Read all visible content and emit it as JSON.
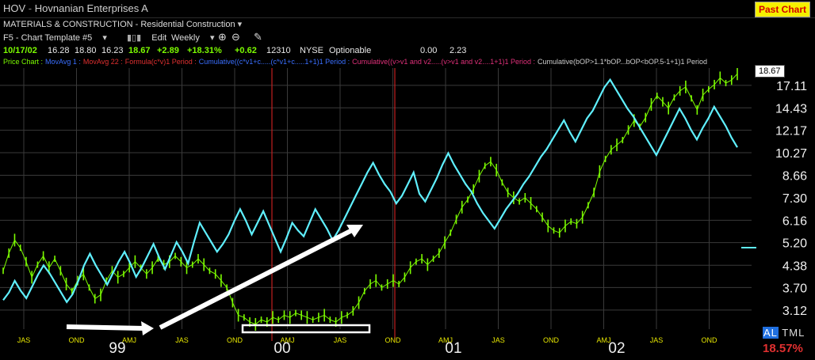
{
  "header": {
    "symbol": "HOV",
    "separator": "-",
    "company": "Hovnanian Enterprises A",
    "past_chart_label": "Past Chart"
  },
  "sector": {
    "label": "MATERIALS & CONSTRUCTION - Residential Construction"
  },
  "toolbar": {
    "template": "F5 - Chart Template #5",
    "edit_label": "Edit",
    "period": "Weekly"
  },
  "quote": {
    "date": "10/17/02",
    "open": "16.28",
    "high": "18.80",
    "low": "16.23",
    "last": "18.67",
    "change": "+2.89",
    "pct_change": "+18.31%",
    "extra_change": "+0.62",
    "volume": "12310",
    "exchange": "NYSE",
    "optionable": "Optionable",
    "val1": "0.00",
    "val2": "2.23"
  },
  "indicators": [
    {
      "text": "Price Chart :",
      "color": "#7cfc00"
    },
    {
      "text": "MovAvg 1 :",
      "color": "#3a6fff"
    },
    {
      "text": "MovAvg 22 :",
      "color": "#e03030"
    },
    {
      "text": "Formula(c*v)1 Period :",
      "color": "#e03030"
    },
    {
      "text": "Cumulative((c*v1+c.....(c*v1+c.....1+1)1 Period :",
      "color": "#3a6fff"
    },
    {
      "text": "Cumulative((v>v1 and v2.....(v>v1 and v2....1+1)1 Period :",
      "color": "#e0307a"
    },
    {
      "text": "Cumulative(bOP>1.1*bOP...bOP<bOP.5-1+1)1 Period",
      "color": "#cccccc"
    }
  ],
  "colors": {
    "price": "#7cfc00",
    "indicator": "#5ff0ff",
    "divider": "#c02020",
    "grid": "#3a3a3a",
    "xlabel": "#e6e600"
  },
  "price_axis": {
    "last_label": "18.67",
    "ticks": [
      "17.11",
      "14.43",
      "12.17",
      "10.27",
      "8.66",
      "7.30",
      "6.16",
      "5.20",
      "4.38",
      "3.70",
      "3.12"
    ]
  },
  "x_axis": {
    "quarters": [
      "JAS",
      "OND",
      "AMJ",
      "JAS",
      "OND",
      "AMJ",
      "JAS",
      "OND",
      "AMJ",
      "JAS",
      "OND",
      "AMJ",
      "JAS",
      "OND"
    ],
    "years": [
      "99",
      "00",
      "01",
      "02"
    ]
  },
  "footer": {
    "tml_al": "AL",
    "tml_rest": "TML",
    "pct": "18.57%"
  },
  "chart_data": {
    "type": "line",
    "scale": "log",
    "ylim": [
      2.7,
      19.5
    ],
    "series": [
      {
        "values": [
          4.2,
          4.8,
          5.3,
          5.0,
          4.5,
          4.0,
          4.4,
          4.7,
          4.3,
          4.6,
          4.2,
          3.8,
          3.6,
          3.9,
          4.1,
          3.7,
          3.4,
          3.5,
          3.9,
          4.2,
          4.0,
          4.1,
          4.3,
          4.5,
          4.3,
          4.1,
          4.3,
          4.6,
          4.4,
          4.5,
          4.7,
          4.5,
          4.3,
          4.4,
          4.6,
          4.4,
          4.2,
          4.1,
          3.9,
          3.7,
          3.3,
          3.0,
          2.95,
          2.85,
          2.8,
          2.9,
          2.85,
          2.95,
          2.9,
          3.0,
          2.95,
          3.05,
          3.0,
          2.95,
          2.9,
          2.95,
          3.0,
          2.9,
          2.85,
          2.95,
          3.0,
          3.1,
          3.3,
          3.6,
          3.8,
          3.9,
          3.7,
          3.8,
          3.9,
          3.8,
          4.0,
          4.3,
          4.5,
          4.6,
          4.4,
          4.6,
          4.8,
          5.2,
          5.6,
          6.2,
          6.8,
          7.2,
          7.8,
          8.6,
          9.3,
          9.6,
          9.0,
          8.2,
          7.6,
          7.3,
          7.1,
          7.3,
          7.0,
          6.7,
          6.3,
          5.9,
          5.7,
          5.6,
          5.9,
          6.1,
          6.0,
          6.3,
          6.9,
          7.6,
          8.9,
          9.8,
          10.5,
          10.9,
          11.3,
          12.2,
          13.1,
          12.5,
          13.4,
          14.8,
          15.8,
          15.1,
          14.4,
          15.6,
          16.4,
          16.9,
          15.5,
          14.2,
          15.9,
          16.6,
          17.2,
          18.1,
          17.4,
          17.8,
          18.67
        ]
      },
      {
        "values": [
          15,
          19,
          25,
          20,
          16,
          22,
          28,
          33,
          29,
          24,
          19,
          14,
          18,
          25,
          33,
          39,
          33,
          28,
          23,
          29,
          35,
          40,
          34,
          27,
          32,
          38,
          44,
          37,
          31,
          38,
          45,
          40,
          34,
          45,
          55,
          50,
          45,
          40,
          44,
          49,
          56,
          62,
          56,
          49,
          55,
          61,
          54,
          47,
          40,
          47,
          55,
          51,
          48,
          55,
          62,
          57,
          52,
          46,
          51,
          57,
          63,
          69,
          75,
          81,
          86,
          80,
          75,
          71,
          65,
          69,
          75,
          81,
          70,
          66,
          72,
          78,
          85,
          91,
          85,
          80,
          75,
          71,
          65,
          60,
          56,
          52,
          57,
          62,
          66,
          70,
          75,
          79,
          84,
          89,
          93,
          98,
          103,
          108,
          102,
          97,
          103,
          109,
          113,
          119,
          125,
          129,
          124,
          119,
          114,
          110,
          105,
          100,
          95,
          90,
          96,
          102,
          108,
          114,
          109,
          103,
          98,
          104,
          109,
          115,
          110,
          105,
          99,
          94
        ]
      }
    ]
  }
}
